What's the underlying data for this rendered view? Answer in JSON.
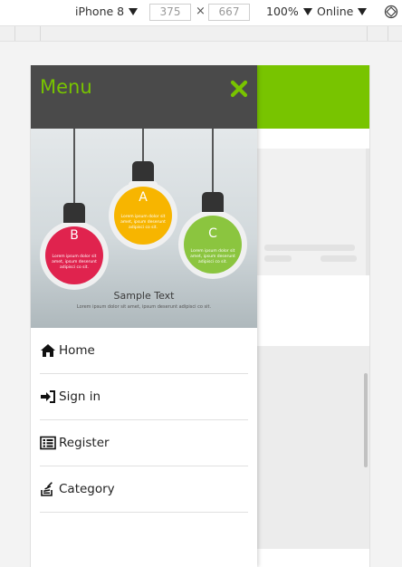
{
  "devtools": {
    "device": "iPhone 8",
    "width": "375",
    "height": "667",
    "zoom": "100%",
    "network": "Online",
    "times_sign": "×"
  },
  "drawer": {
    "title": "Menu",
    "image": {
      "bulbs": [
        {
          "letter": "B",
          "color": "#e0234e",
          "caption": "Lorem ipsum dolor sit amet, ipsum deserunt adipisci co sit."
        },
        {
          "letter": "A",
          "color": "#f7b500",
          "caption": "Lorem ipsum dolor sit amet, ipsum deserunt adipisci co sit."
        },
        {
          "letter": "C",
          "color": "#8bc53f",
          "caption": "Lorem ipsum dolor sit amet, ipsum deserunt adipisci co sit."
        }
      ],
      "sample_text": "Sample Text",
      "sample_caption": "Lorem ipsum dolor sit amet, ipsum deserunt adipisci co sit."
    },
    "items": [
      {
        "label": "Home",
        "icon": "home-icon"
      },
      {
        "label": "Sign in",
        "icon": "sign-in-icon"
      },
      {
        "label": "Register",
        "icon": "register-icon"
      },
      {
        "label": "Category",
        "icon": "category-icon"
      }
    ]
  },
  "colors": {
    "brand": "#78c400",
    "drawer_header": "#4a4a4a"
  }
}
